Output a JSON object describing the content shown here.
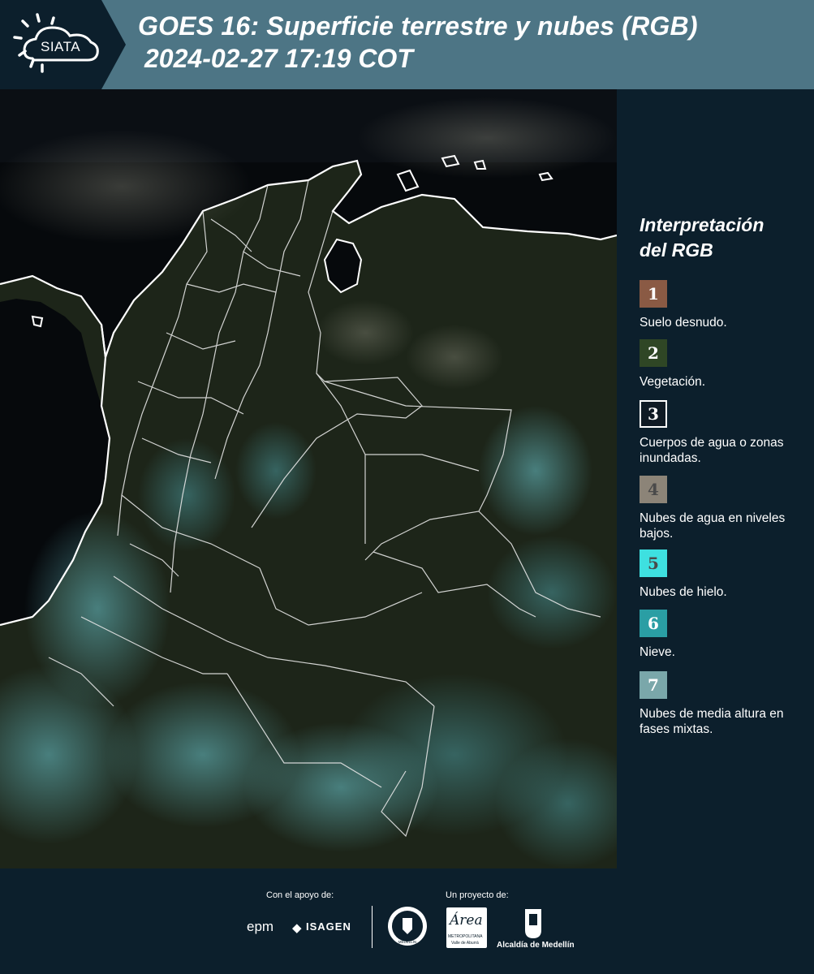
{
  "header": {
    "logo_text": "SIATA",
    "title_line1": "GOES 16: Superficie terrestre y nubes (RGB)",
    "title_line2": "2024-02-27 17:19 COT"
  },
  "legend": {
    "title_line1": "Interpretación",
    "title_line2": "del RGB",
    "items": [
      {
        "number": "1",
        "label": "Suelo desnudo.",
        "color": "#8a5a44"
      },
      {
        "number": "2",
        "label": "Vegetación.",
        "color": "#2f4625"
      },
      {
        "number": "3",
        "label": "Cuerpos de agua o zonas inundadas.",
        "color": "#0f1a24"
      },
      {
        "number": "4",
        "label": "Nubes de agua en niveles bajos.",
        "color": "#8c8478"
      },
      {
        "number": "5",
        "label": "Nubes de hielo.",
        "color": "#3ee0e0"
      },
      {
        "number": "6",
        "label": "Nieve.",
        "color": "#2a9ea4"
      },
      {
        "number": "7",
        "label": "Nubes de media altura en fases mixtas.",
        "color": "#7aa7aa"
      }
    ]
  },
  "footer": {
    "support_caption": "Con el apoyo de:",
    "project_caption": "Un proyecto de:",
    "epm_text": "epm",
    "isagen_text": "ISAGEN",
    "medellin_seal_text": "MEDELLÍN",
    "area_text": "Área",
    "area_sub": "METROPOLITANA",
    "area_sub2": "Valle de Aburrá",
    "alcaldia_text": "Alcaldía de Medellín"
  },
  "colors": {
    "header_bg": "#4d7585",
    "page_bg": "#0c1f2c",
    "map_land": "#1e2619",
    "map_sea": "#05080b",
    "cloud_cyan": "#5fb8bf",
    "border_white": "#ffffff"
  }
}
